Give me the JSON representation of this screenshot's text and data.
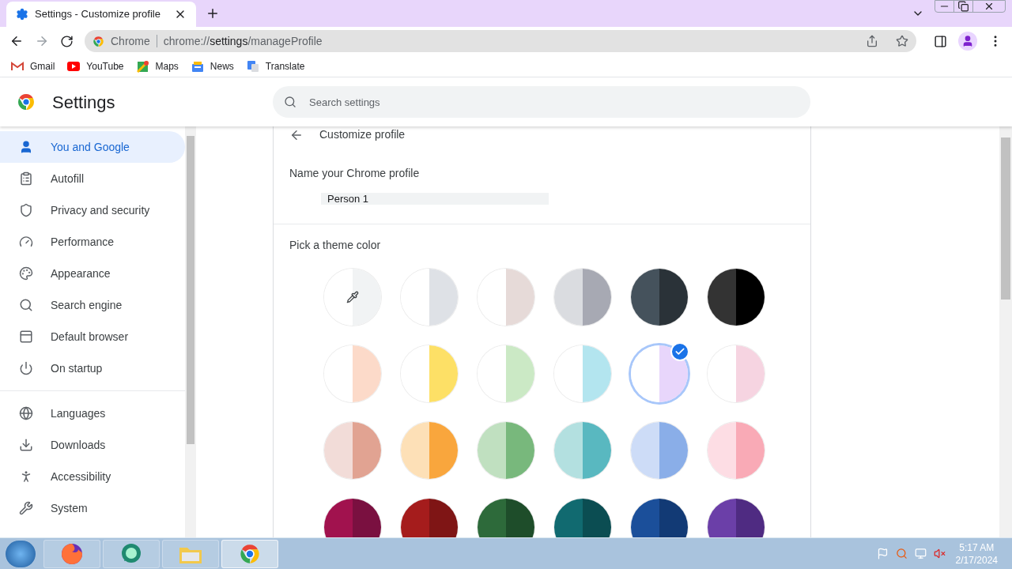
{
  "tab": {
    "title": "Settings - Customize profile",
    "selected": true
  },
  "address_bar": {
    "site_label": "Chrome",
    "url_host": "chrome://",
    "url_path_bold": "settings",
    "url_path": "/manageProfile"
  },
  "bookmarks": [
    {
      "kind": "gmail",
      "label": "Gmail"
    },
    {
      "kind": "youtube",
      "label": "YouTube"
    },
    {
      "kind": "maps",
      "label": "Maps"
    },
    {
      "kind": "news",
      "label": "News"
    },
    {
      "kind": "translate",
      "label": "Translate"
    }
  ],
  "settings_header": {
    "title": "Settings",
    "search_placeholder": "Search settings"
  },
  "sidebar": {
    "sections": [
      [
        {
          "kind": "person",
          "label": "You and Google",
          "selected": true
        },
        {
          "kind": "clipboard",
          "label": "Autofill",
          "selected": false
        },
        {
          "kind": "shield",
          "label": "Privacy and security",
          "selected": false
        },
        {
          "kind": "gauge",
          "label": "Performance",
          "selected": false
        },
        {
          "kind": "palette",
          "label": "Appearance",
          "selected": false
        },
        {
          "kind": "search",
          "label": "Search engine",
          "selected": false
        },
        {
          "kind": "browser",
          "label": "Default browser",
          "selected": false
        },
        {
          "kind": "power",
          "label": "On startup",
          "selected": false
        }
      ],
      [
        {
          "kind": "globe",
          "label": "Languages",
          "selected": false
        },
        {
          "kind": "download",
          "label": "Downloads",
          "selected": false
        },
        {
          "kind": "accessibility",
          "label": "Accessibility",
          "selected": false
        },
        {
          "kind": "wrench",
          "label": "System",
          "selected": false
        }
      ]
    ]
  },
  "customize_profile": {
    "title": "Customize profile",
    "name_label": "Name your Chrome profile",
    "name_value": "Person 1",
    "theme_label": "Pick a theme color",
    "swatches": [
      {
        "kind": "custom",
        "halves": [
          {
            "color": "#ffffff"
          },
          {
            "color": "#f1f3f4"
          }
        ],
        "selected": false
      },
      {
        "kind": "color",
        "halves": [
          {
            "color": "#ffffff"
          },
          {
            "color": "#dee1e6"
          }
        ],
        "selected": false
      },
      {
        "kind": "color",
        "halves": [
          {
            "color": "#ffffff"
          },
          {
            "color": "#e6dad8"
          }
        ],
        "selected": false
      },
      {
        "kind": "color",
        "halves": [
          {
            "color": "#dadce0"
          },
          {
            "color": "#a7a9b3"
          }
        ],
        "selected": false
      },
      {
        "kind": "color",
        "halves": [
          {
            "color": "#45525c"
          },
          {
            "color": "#2a3238"
          }
        ],
        "selected": false
      },
      {
        "kind": "color",
        "halves": [
          {
            "color": "#333333"
          },
          {
            "color": "#000000"
          }
        ],
        "selected": false
      },
      {
        "kind": "color",
        "halves": [
          {
            "color": "#ffffff"
          },
          {
            "color": "#fcdac9"
          }
        ],
        "selected": false
      },
      {
        "kind": "color",
        "halves": [
          {
            "color": "#ffffff"
          },
          {
            "color": "#fde066"
          }
        ],
        "selected": false
      },
      {
        "kind": "color",
        "halves": [
          {
            "color": "#ffffff"
          },
          {
            "color": "#cbe9c5"
          }
        ],
        "selected": false
      },
      {
        "kind": "color",
        "halves": [
          {
            "color": "#ffffff"
          },
          {
            "color": "#b3e5ef"
          }
        ],
        "selected": false
      },
      {
        "kind": "color",
        "halves": [
          {
            "color": "#ffffff"
          },
          {
            "color": "#e8d6fb"
          }
        ],
        "selected": true
      },
      {
        "kind": "color",
        "halves": [
          {
            "color": "#ffffff"
          },
          {
            "color": "#f6d4e1"
          }
        ],
        "selected": false
      },
      {
        "kind": "color",
        "halves": [
          {
            "color": "#f2dcd8"
          },
          {
            "color": "#e1a392"
          }
        ],
        "selected": false
      },
      {
        "kind": "color",
        "halves": [
          {
            "color": "#fde0b7"
          },
          {
            "color": "#f9a63d"
          }
        ],
        "selected": false
      },
      {
        "kind": "color",
        "halves": [
          {
            "color": "#c0e0c0"
          },
          {
            "color": "#78b87c"
          }
        ],
        "selected": false
      },
      {
        "kind": "color",
        "halves": [
          {
            "color": "#b3e0e0"
          },
          {
            "color": "#59b8c0"
          }
        ],
        "selected": false
      },
      {
        "kind": "color",
        "halves": [
          {
            "color": "#cddcf7"
          },
          {
            "color": "#8aaee8"
          }
        ],
        "selected": false
      },
      {
        "kind": "color",
        "halves": [
          {
            "color": "#fddde4"
          },
          {
            "color": "#f9aab6"
          }
        ],
        "selected": false
      },
      {
        "kind": "color",
        "halves": [
          {
            "color": "#a1124e"
          },
          {
            "color": "#7a1040"
          }
        ],
        "selected": false
      },
      {
        "kind": "color",
        "halves": [
          {
            "color": "#a51c1c"
          },
          {
            "color": "#7f1515"
          }
        ],
        "selected": false
      },
      {
        "kind": "color",
        "halves": [
          {
            "color": "#2d6a3a"
          },
          {
            "color": "#1e4d2a"
          }
        ],
        "selected": false
      },
      {
        "kind": "color",
        "halves": [
          {
            "color": "#116a70"
          },
          {
            "color": "#0b4d52"
          }
        ],
        "selected": false
      },
      {
        "kind": "color",
        "halves": [
          {
            "color": "#1b4f9a"
          },
          {
            "color": "#123a75"
          }
        ],
        "selected": false
      },
      {
        "kind": "color",
        "halves": [
          {
            "color": "#6b3fa8"
          },
          {
            "color": "#4f2b82"
          }
        ],
        "selected": false
      }
    ]
  },
  "taskbar": {
    "apps": [
      {
        "kind": "firefox",
        "selected": false
      },
      {
        "kind": "bubble",
        "selected": false
      },
      {
        "kind": "folder",
        "selected": false
      },
      {
        "kind": "chrome",
        "selected": true
      }
    ],
    "time": "5:17 AM",
    "date": "2/17/2024"
  }
}
